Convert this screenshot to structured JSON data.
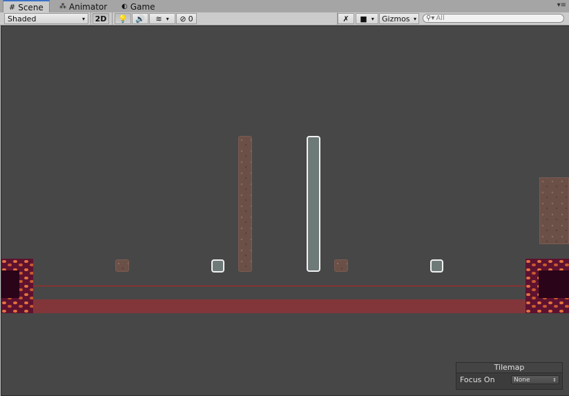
{
  "tabs": [
    {
      "label": "Scene",
      "icon": "grid-icon",
      "active": true
    },
    {
      "label": "Animator",
      "icon": "animator-icon",
      "active": false
    },
    {
      "label": "Game",
      "icon": "game-icon",
      "active": false
    }
  ],
  "toolbar": {
    "draw_mode": "Shaded",
    "mode_2d": "2D",
    "hidden_count": "0",
    "gizmos": "Gizmos",
    "search_placeholder": "All"
  },
  "tilemap_panel": {
    "title": "Tilemap",
    "focus_label": "Focus On",
    "focus_value": "None"
  },
  "colors": {
    "viewport_bg": "#474747",
    "brick": "#e2733e",
    "dirt": "#6b5048",
    "selection_outline": "#f2f2f2",
    "red_band": "#82363a",
    "red_line": "#c02020"
  }
}
